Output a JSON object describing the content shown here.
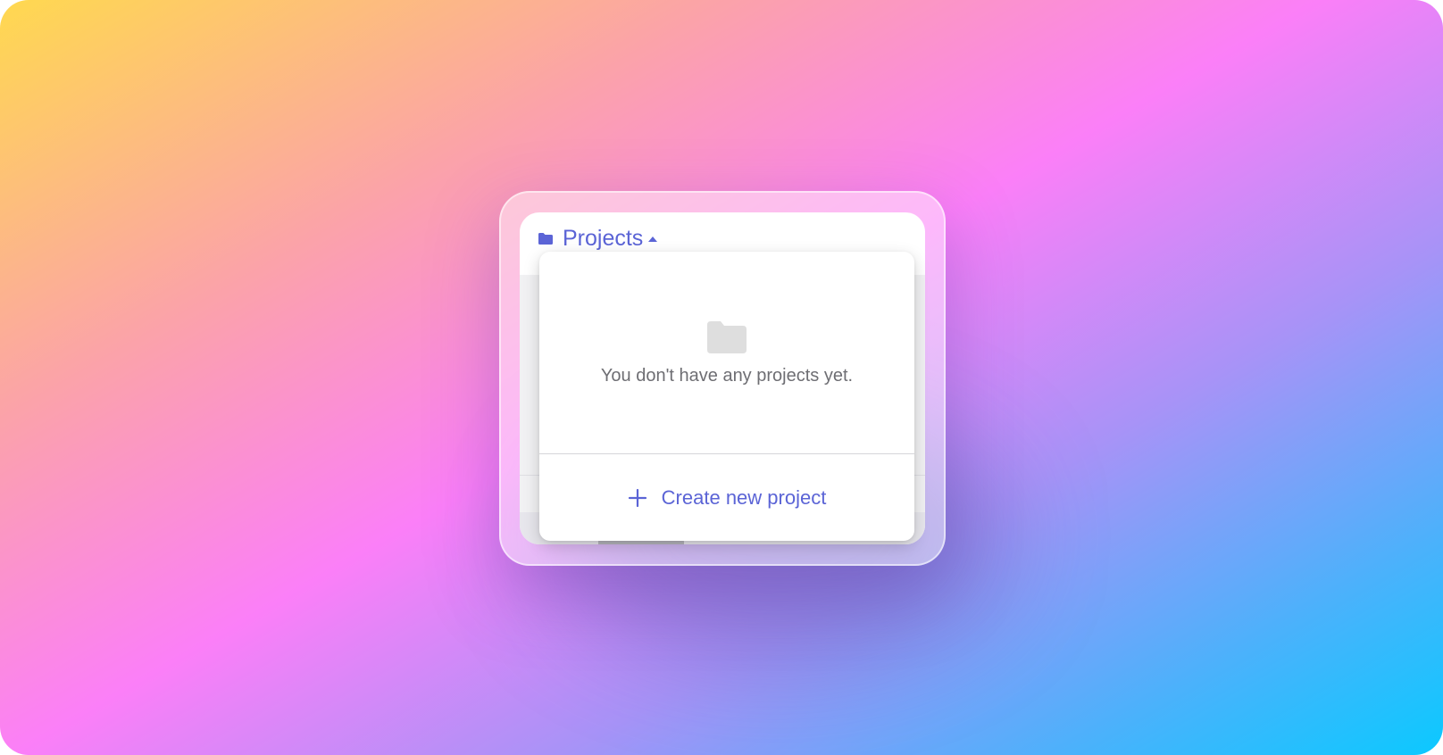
{
  "colors": {
    "accent": "#5b64d6",
    "muted_text": "#6e6e73",
    "placeholder_icon": "#dedede"
  },
  "header": {
    "icon": "folder-icon",
    "title": "Projects",
    "caret_icon": "caret-up-icon"
  },
  "dropdown": {
    "empty_icon": "folder-icon",
    "empty_message": "You don't have any projects yet.",
    "create_icon": "plus-icon",
    "create_label": "Create new project"
  }
}
